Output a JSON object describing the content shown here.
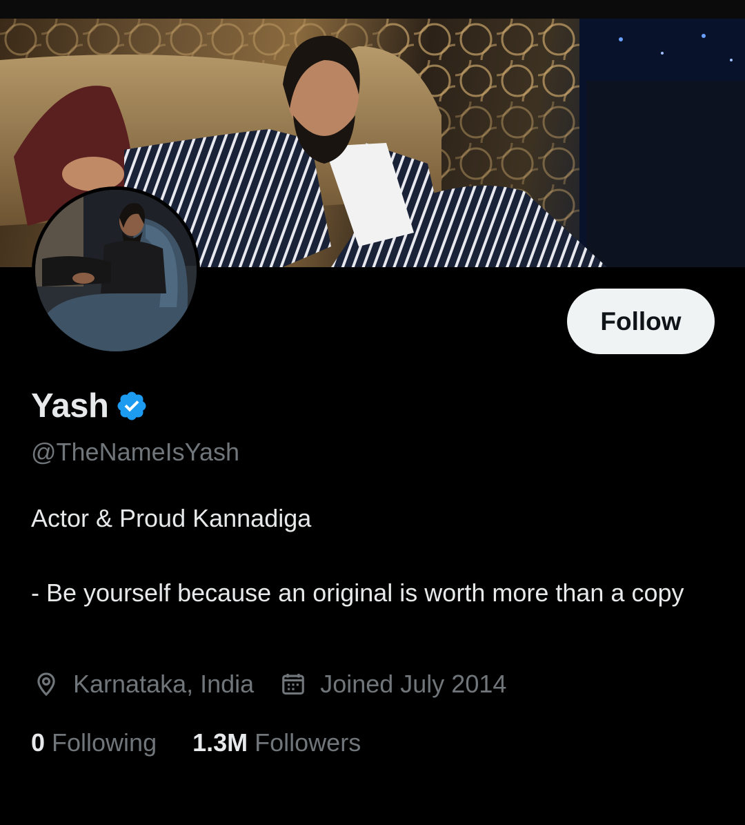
{
  "profile": {
    "display_name": "Yash",
    "verified": true,
    "handle": "@TheNameIsYash",
    "bio_line_1": "Actor & Proud Kannadiga",
    "bio_line_2": "- Be yourself because an original is worth more than a copy",
    "location": "Karnataka, India",
    "joined": "Joined July 2014",
    "following_count": "0",
    "following_label": "Following",
    "followers_count": "1.3M",
    "followers_label": "Followers"
  },
  "actions": {
    "follow_label": "Follow"
  },
  "icons": {
    "verified": "verified-badge-icon",
    "location": "location-pin-icon",
    "calendar": "calendar-icon"
  },
  "colors": {
    "background": "#000000",
    "primary_text": "#e7e9ea",
    "secondary_text": "#71767b",
    "verified_blue": "#1d9bf0",
    "follow_button_bg": "#eff3f4"
  }
}
